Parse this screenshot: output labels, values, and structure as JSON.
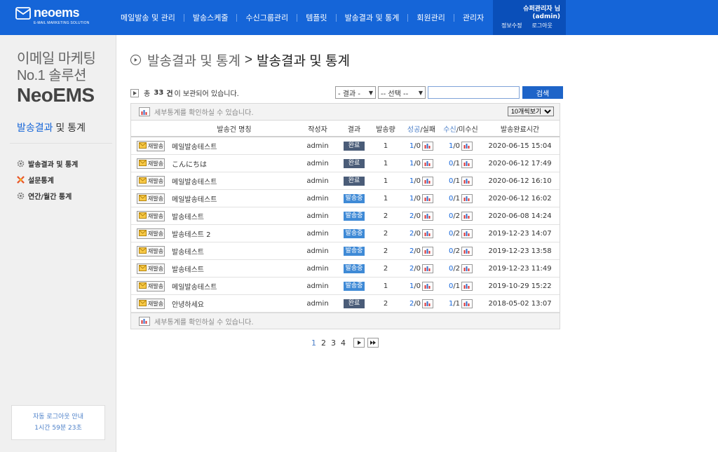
{
  "header": {
    "brand": "neoems",
    "brand_tag": "E-MAIL MARKETING SOLUTION",
    "nav": [
      "메일발송 및 관리",
      "발송스케줄",
      "수신그룹관리",
      "템플릿",
      "발송결과 및 통계",
      "회원관리",
      "관리자"
    ],
    "user_name": "슈퍼관리자 님",
    "user_id": "(admin)",
    "edit_profile": "정보수정",
    "logout": "로그아웃"
  },
  "sidebar": {
    "slogan_line1": "이메일 마케팅",
    "slogan_line2": "No.1 솔루션",
    "slogan_line3": "NeoEMS",
    "section_title_blue": "발송결과",
    "section_title_rest": " 및 통계",
    "menu": [
      "발송결과 및 통계",
      "설문통계",
      "연간/월간 통계"
    ],
    "autologout_title": "자동 로그아웃 안내",
    "autologout_time": "1시간 59분 23초"
  },
  "main": {
    "crumb": "발송결과 및 통계",
    "gt": ">",
    "title": "발송결과 및 통계",
    "summary_pre": "총",
    "summary_count": "33",
    "summary_unit": "건",
    "summary_post": "이 보관되어 있습니다.",
    "filter_result": "- 결과 -",
    "filter_select": "-- 선택 --",
    "search_value": "",
    "search_button": "검색",
    "info_text": "세부통계를 확인하실 수 있습니다.",
    "per_page": "10개씩보기"
  },
  "table": {
    "headers": {
      "name": "발송건 명칭",
      "author": "작성자",
      "result": "결과",
      "volume": "발송량",
      "success": "성공",
      "fail": "/실패",
      "recv": "수신",
      "unrecv": "/미수신",
      "done_time": "발송완료시간"
    },
    "resend_label": "재발송",
    "rows": [
      {
        "name": "메일발송테스트",
        "author": "admin",
        "status": "완료",
        "status_type": "done",
        "volume": "1",
        "success": "1",
        "fail": "/0",
        "recv": "1",
        "unrecv": "/0",
        "time": "2020-06-15 15:04"
      },
      {
        "name": "こんにちは",
        "author": "admin",
        "status": "완료",
        "status_type": "done",
        "volume": "1",
        "success": "1",
        "fail": "/0",
        "recv": "0",
        "unrecv": "/1",
        "time": "2020-06-12 17:49"
      },
      {
        "name": "메일발송테스트",
        "author": "admin",
        "status": "완료",
        "status_type": "done",
        "volume": "1",
        "success": "1",
        "fail": "/0",
        "recv": "0",
        "unrecv": "/1",
        "time": "2020-06-12 16:10"
      },
      {
        "name": "메일발송테스트",
        "author": "admin",
        "status": "발송중",
        "status_type": "sending",
        "volume": "1",
        "success": "1",
        "fail": "/0",
        "recv": "0",
        "unrecv": "/1",
        "time": "2020-06-12 16:02"
      },
      {
        "name": "발송테스트",
        "author": "admin",
        "status": "발송중",
        "status_type": "sending",
        "volume": "2",
        "success": "2",
        "fail": "/0",
        "recv": "0",
        "unrecv": "/2",
        "time": "2020-06-08 14:24"
      },
      {
        "name": "발송테스트 2",
        "author": "admin",
        "status": "발송중",
        "status_type": "sending",
        "volume": "2",
        "success": "2",
        "fail": "/0",
        "recv": "0",
        "unrecv": "/2",
        "time": "2019-12-23 14:07"
      },
      {
        "name": "발송테스트",
        "author": "admin",
        "status": "발송중",
        "status_type": "sending",
        "volume": "2",
        "success": "2",
        "fail": "/0",
        "recv": "0",
        "unrecv": "/2",
        "time": "2019-12-23 13:58"
      },
      {
        "name": "발송테스트",
        "author": "admin",
        "status": "발송중",
        "status_type": "sending",
        "volume": "2",
        "success": "2",
        "fail": "/0",
        "recv": "0",
        "unrecv": "/2",
        "time": "2019-12-23 11:49"
      },
      {
        "name": "메일발송테스트",
        "author": "admin",
        "status": "발송중",
        "status_type": "sending",
        "volume": "1",
        "success": "1",
        "fail": "/0",
        "recv": "0",
        "unrecv": "/1",
        "time": "2019-10-29 15:22"
      },
      {
        "name": "안녕하세요",
        "author": "admin",
        "status": "완료",
        "status_type": "done",
        "volume": "2",
        "success": "2",
        "fail": "/0",
        "recv": "1",
        "unrecv": "/1",
        "time": "2018-05-02 13:07"
      }
    ]
  },
  "pagination": {
    "pages": [
      "1",
      "2",
      "3",
      "4"
    ],
    "active": "1"
  },
  "colors": {
    "header_bg": "#1565d8",
    "badge_done": "#4a5c78",
    "badge_sending": "#3f8ad6",
    "accent": "#4b7fc8"
  }
}
